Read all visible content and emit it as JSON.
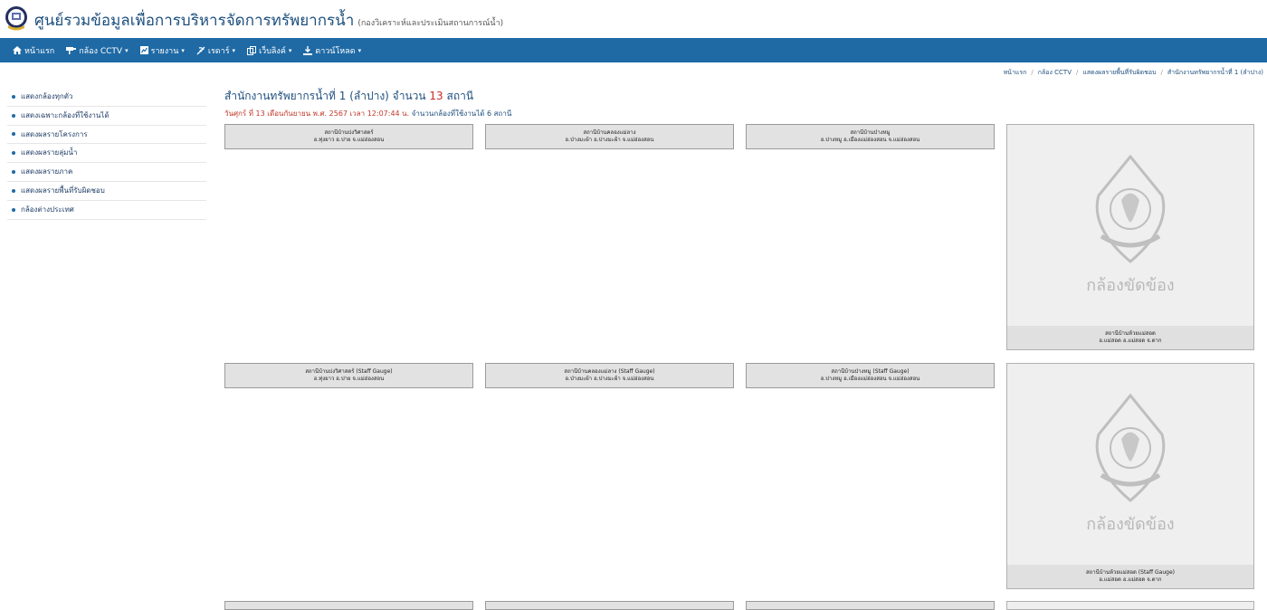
{
  "header": {
    "title": "ศูนย์รวมข้อมูลเพื่อการบริหารจัดการทรัพยากรน้ำ",
    "subtitle": "(กองวิเคราะห์และประเมินสถานการณ์น้ำ)"
  },
  "nav": [
    {
      "label": "หน้าแรก",
      "icon": "home-icon",
      "dropdown": false
    },
    {
      "label": "กล้อง CCTV",
      "icon": "cctv-icon",
      "dropdown": true
    },
    {
      "label": "รายงาน",
      "icon": "report-icon",
      "dropdown": true
    },
    {
      "label": "เรดาร์",
      "icon": "radar-icon",
      "dropdown": true
    },
    {
      "label": "เว็บลิงค์",
      "icon": "link-icon",
      "dropdown": true
    },
    {
      "label": "ดาวน์โหลด",
      "icon": "download-icon",
      "dropdown": true
    }
  ],
  "breadcrumb": [
    "หน้าแรก",
    "กล้อง CCTV",
    "แสดงผลรายพื้นที่รับผิดชอบ",
    "สำนักงานทรัพยากรน้ำที่ 1 (ลำปาง)"
  ],
  "sidebar": [
    "แสดงกล้องทุกตัว",
    "แสดงเฉพาะกล้องที่ใช้งานได้",
    "แสดงผลรายโครงการ",
    "แสดงผลรายลุ่มน้ำ",
    "แสดงผลรายภาค",
    "แสดงผลรายพื้นที่รับผิดชอบ",
    "กล้องต่างประเทศ"
  ],
  "content": {
    "title_prefix": "สำนักงานทรัพยากรน้ำที่ 1 (ลำปาง) จำนวน",
    "title_count": "13",
    "title_suffix": "สถานี",
    "date_text": "วันศุกร์ ที่ 13 เดือนกันยายน พ.ศ. 2567 เวลา 12:07:44 น.",
    "working_text": "จำนวนกล้องที่ใช้งานได้ 6 สถานี"
  },
  "stations": [
    {
      "name": "สถานีบ้านปงวิศาสตร์",
      "location": "อ.ทุ่งยาว อ.ปาย จ.แม่ฮ่องสอน",
      "offline": false
    },
    {
      "name": "สถานีบ้านคลองแม่ลาง",
      "location": "อ.ป่างมะผ้า อ.ปางมะผ้า จ.แม่ฮ่องสอน",
      "offline": false
    },
    {
      "name": "สถานีบ้านป่างหมู",
      "location": "อ.ปางหมู อ.เมืองแม่ฮ่องสอน จ.แม่ฮ่องสอน",
      "offline": false
    },
    {
      "name": "สถานีบ้านห้วยแม่สอด",
      "location": "อ.แม่สอด อ.แม่สอด จ.ตาก",
      "offline": true,
      "offline_label": "กล้องขัดข้อง"
    },
    {
      "name": "สถานีบ้านปงวิศาสตร์ (Staff Gauge)",
      "location": "อ.ทุ่งยาว อ.ปาย จ.แม่ฮ่องสอน",
      "offline": false
    },
    {
      "name": "สถานีบ้านคลองแม่ลาง (Staff Gauge)",
      "location": "อ.ป่างมะผ้า อ.ปางมะผ้า จ.แม่ฮ่องสอน",
      "offline": false
    },
    {
      "name": "สถานีบ้านป่างหมู (Staff Gauge)",
      "location": "อ.ปางหมู อ.เมืองแม่ฮ่องสอน จ.แม่ฮ่องสอน",
      "offline": false
    },
    {
      "name": "สถานีบ้านห้วยแม่สอด (Staff Gauge)",
      "location": "อ.แม่สอด อ.แม่สอด จ.ตาก",
      "offline": true,
      "offline_label": "กล้องขัดข้อง"
    }
  ]
}
